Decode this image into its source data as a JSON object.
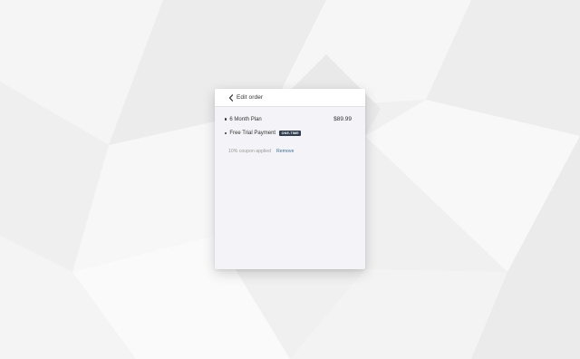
{
  "header": {
    "back_label": "Edit order"
  },
  "order": {
    "items": [
      {
        "label": "6 Month Plan",
        "price": "$89.99"
      },
      {
        "label": "Free Trial Payment",
        "badge": "ONE-TIME"
      }
    ],
    "coupon": {
      "text": "10% coupon applied",
      "remove_label": "Remove"
    }
  },
  "colors": {
    "badge_bg": "#2f3e4e",
    "link": "#3b6f9a"
  }
}
